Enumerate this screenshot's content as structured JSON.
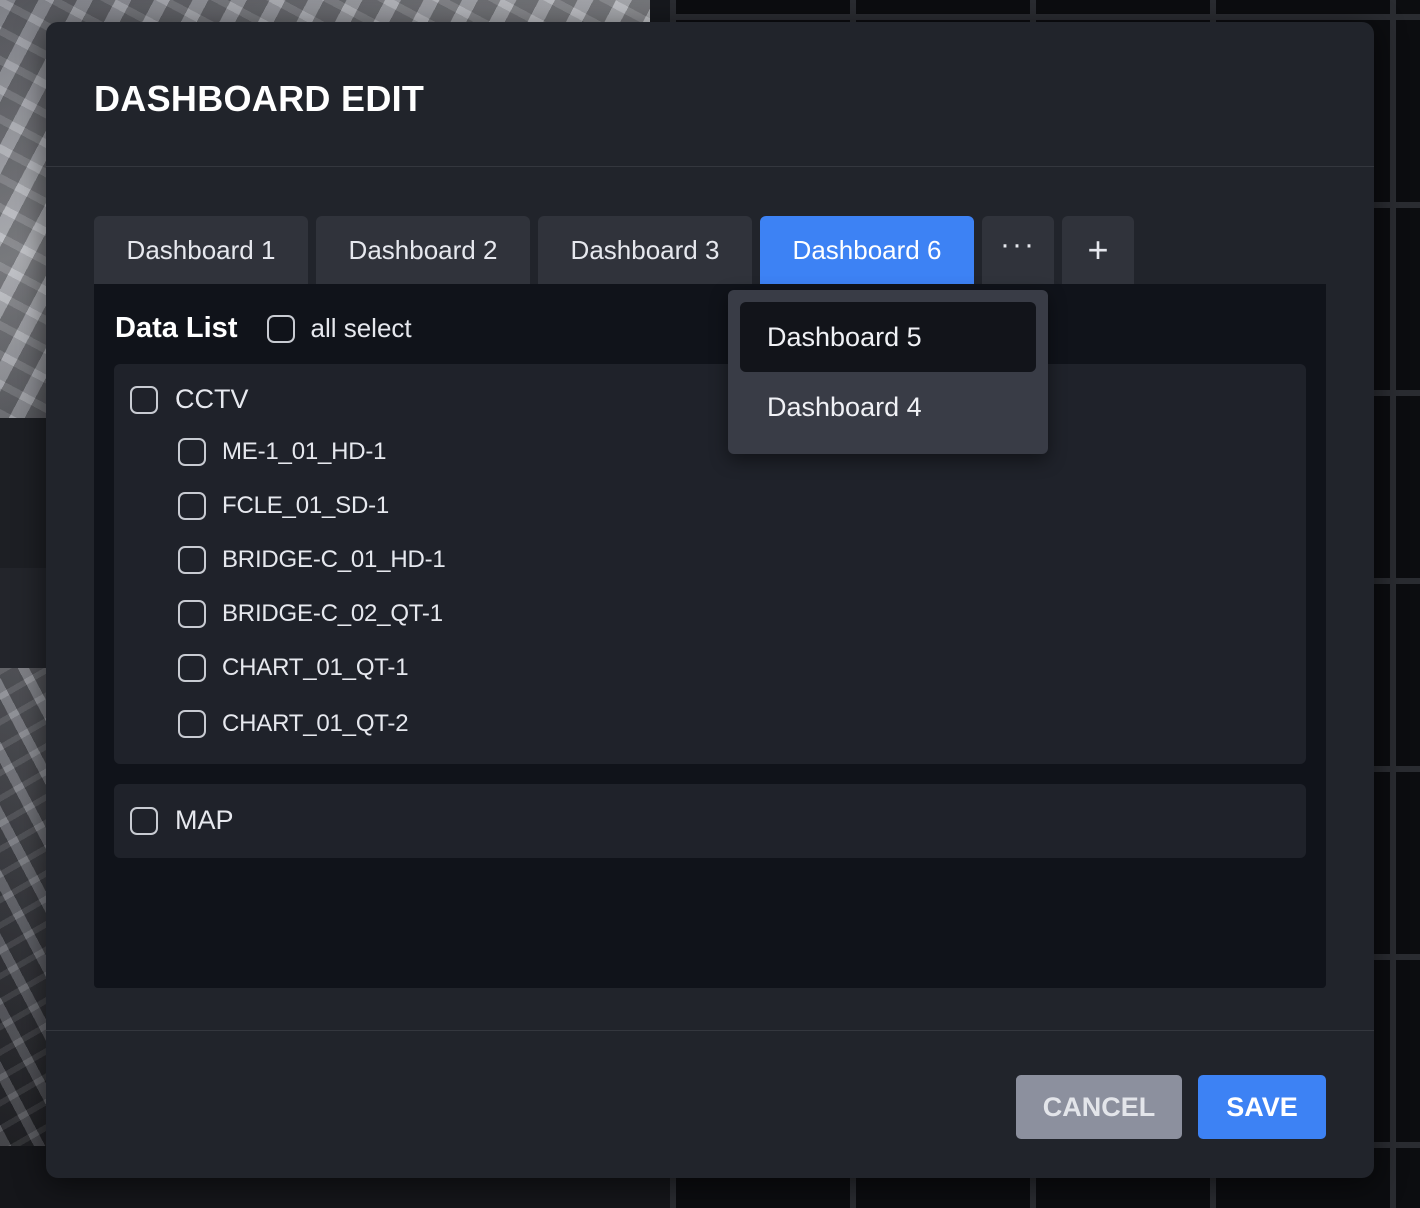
{
  "modal": {
    "title": "DASHBOARD EDIT"
  },
  "tabs": [
    {
      "label": "Dashboard 1",
      "active": false
    },
    {
      "label": "Dashboard 2",
      "active": false
    },
    {
      "label": "Dashboard 3",
      "active": false
    },
    {
      "label": "Dashboard 6",
      "active": true
    }
  ],
  "tab_icons": {
    "more": "more-horizontal-icon",
    "more_glyph": "···",
    "add": "plus-icon",
    "add_glyph": "+"
  },
  "dropdown": {
    "items": [
      "Dashboard 5",
      "Dashboard 4"
    ]
  },
  "data_list": {
    "title": "Data List",
    "all_select_label": "all select",
    "all_select_checked": false,
    "groups": [
      {
        "label": "CCTV",
        "checked": false,
        "items": [
          {
            "label": "ME-1_01_HD-1",
            "checked": false
          },
          {
            "label": "FCLE_01_SD-1",
            "checked": false
          },
          {
            "label": "BRIDGE-C_01_HD-1",
            "checked": false
          },
          {
            "label": "BRIDGE-C_02_QT-1",
            "checked": false
          },
          {
            "label": "CHART_01_QT-1",
            "checked": false
          },
          {
            "label": "CHART_01_QT-2",
            "checked": false
          }
        ]
      },
      {
        "label": "MAP",
        "checked": false,
        "items": []
      }
    ]
  },
  "footer": {
    "cancel_label": "CANCEL",
    "save_label": "SAVE"
  },
  "colors": {
    "accent": "#3d82f4",
    "modal_bg": "#21242b",
    "panel_bg": "#10131a",
    "cancel_bg": "#8c909e"
  }
}
